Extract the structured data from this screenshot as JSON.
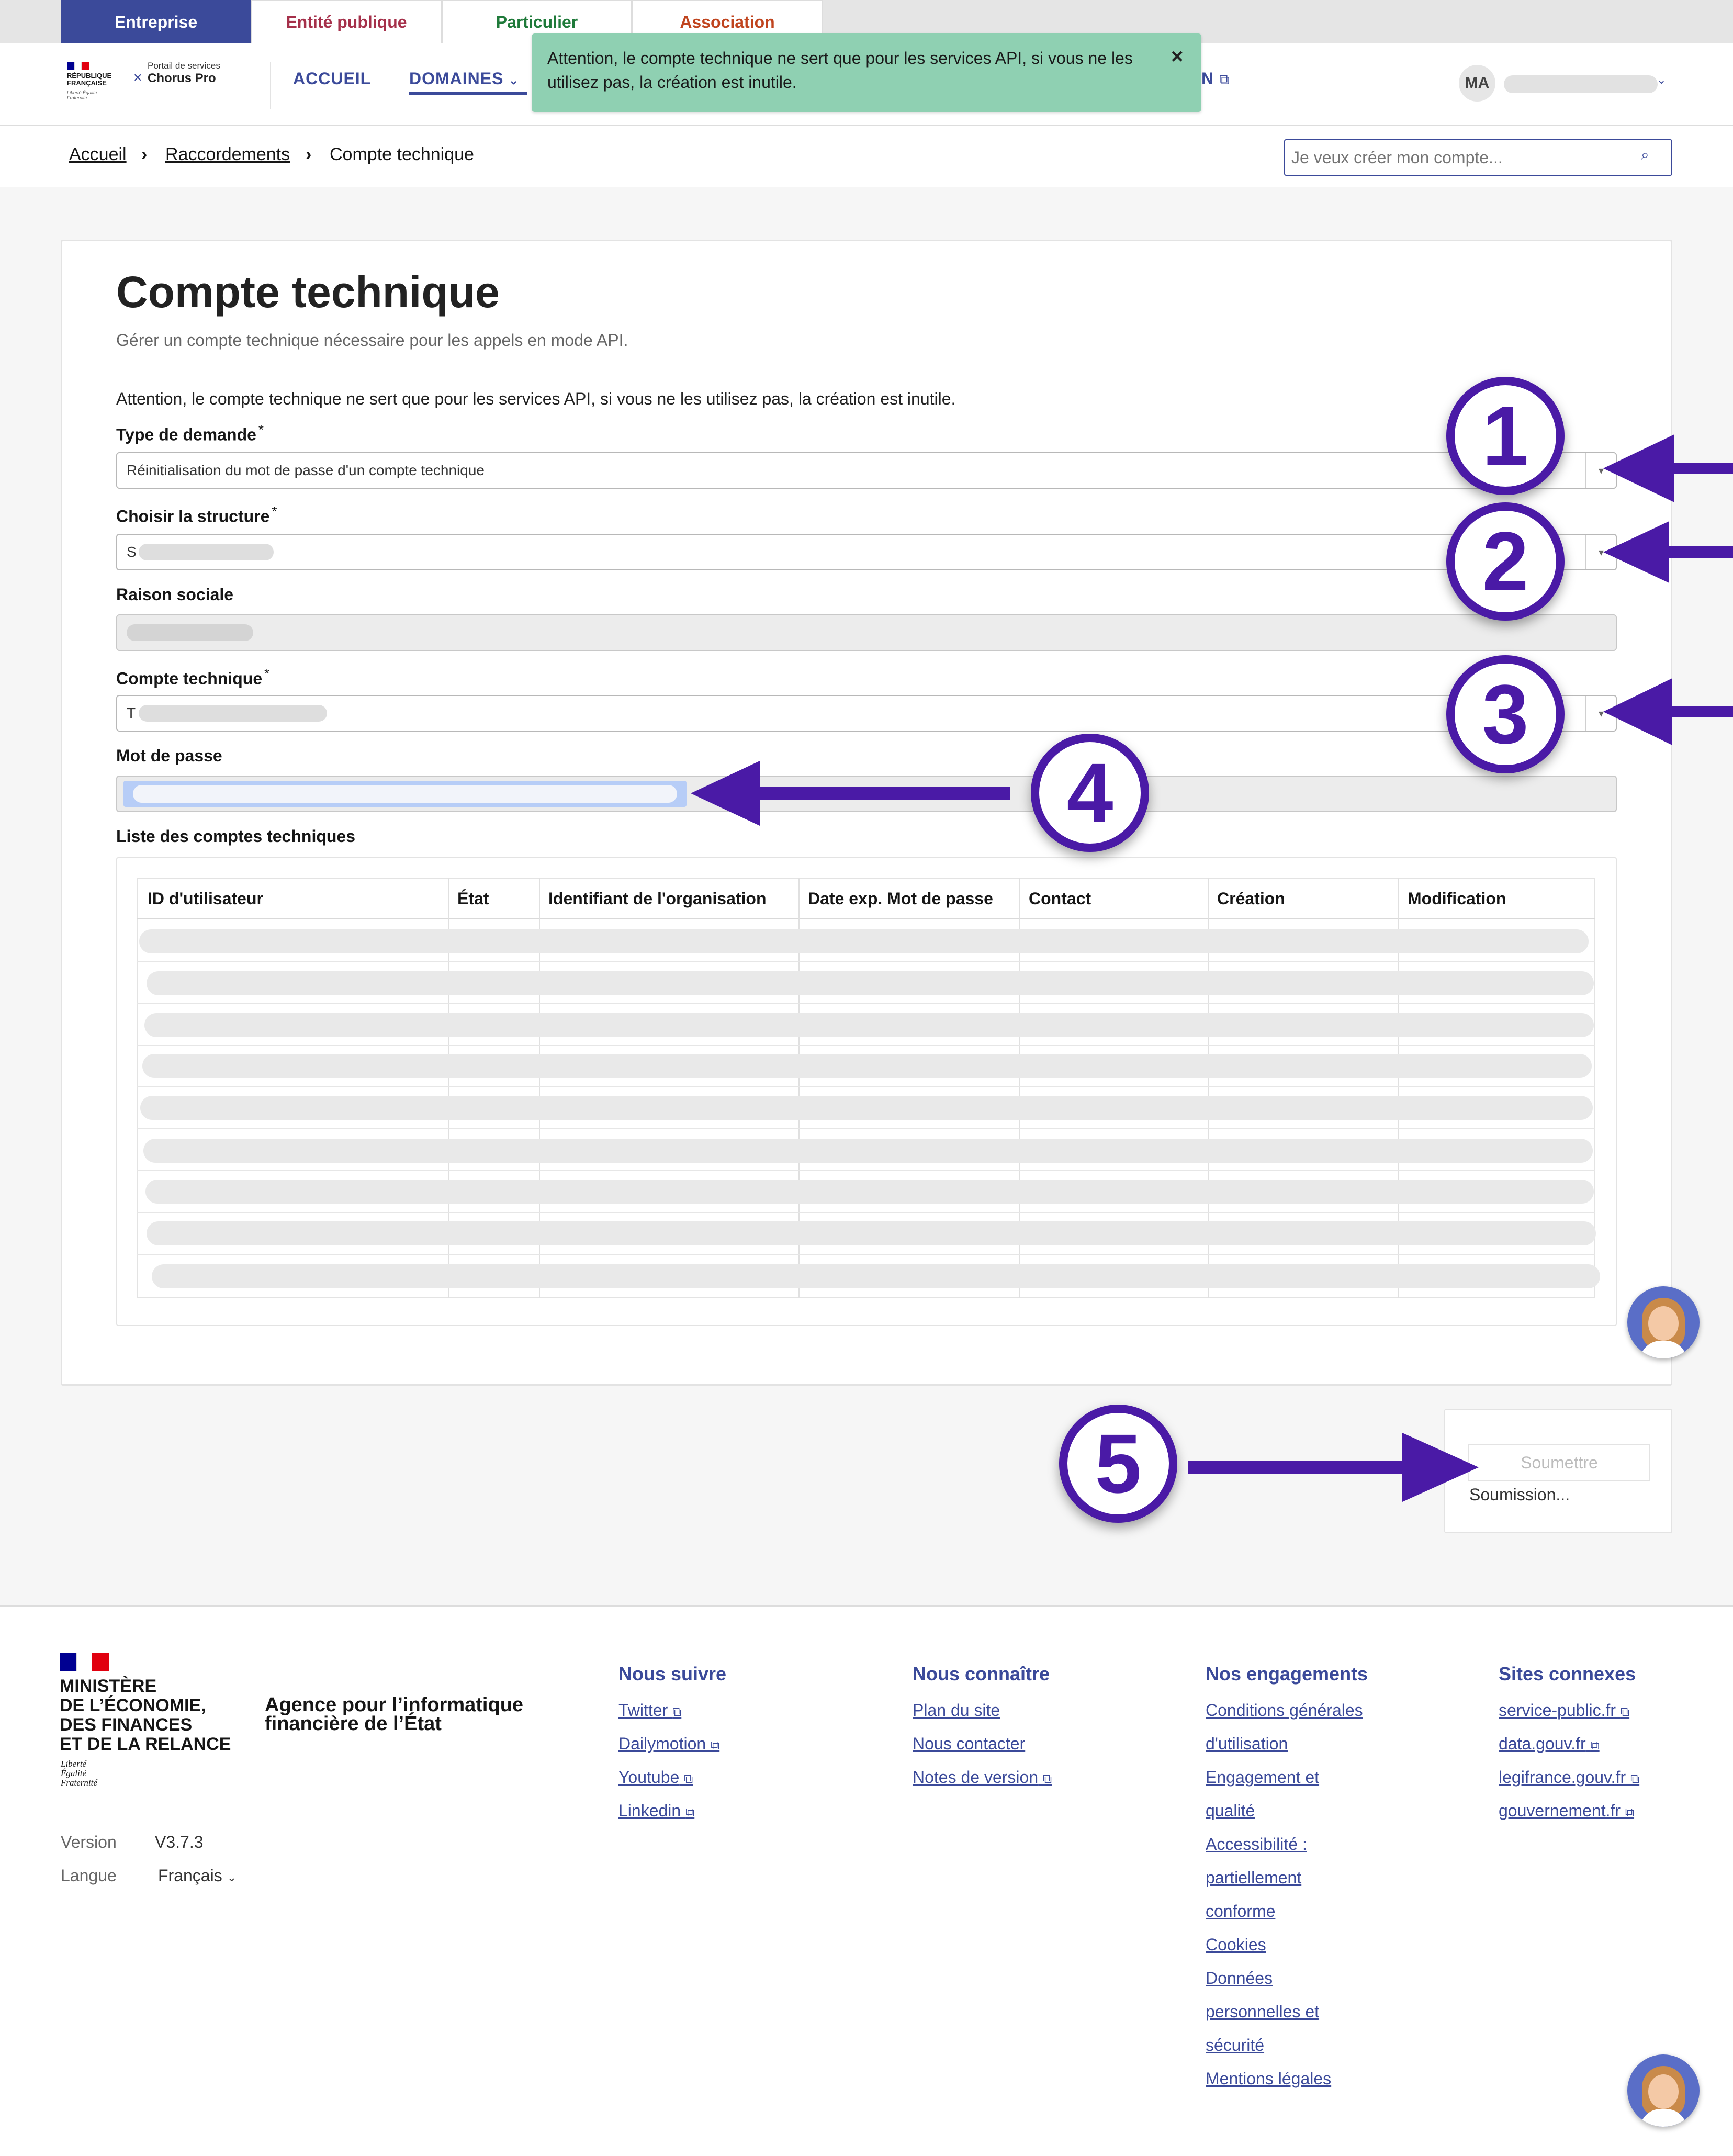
{
  "audience_tabs": [
    {
      "label": "Entreprise",
      "color": "#ffffff",
      "bg": "#3b4a9a"
    },
    {
      "label": "Entité publique",
      "color": "#a5304a",
      "bg": "#ffffff"
    },
    {
      "label": "Particulier",
      "color": "#1f7a3a",
      "bg": "#ffffff"
    },
    {
      "label": "Association",
      "color": "#c0441e",
      "bg": "#ffffff"
    }
  ],
  "header": {
    "logo_text_1": "RÉPUBLIQUE",
    "logo_text_2": "FRANÇAISE",
    "logo_motto": "Liberté Égalité Fraternité",
    "portal_label": "Portail de services",
    "portal_name": "Chorus Pro",
    "nav_home": "ACCUEIL",
    "nav_domains": "DOMAINES",
    "nav_partial": "N",
    "user_initials": "MA"
  },
  "toast": {
    "message": "Attention, le compte technique ne sert que pour les services API, si vous ne les utilisez pas, la création est inutile.",
    "close": "×",
    "bg": "#8fd0b2"
  },
  "breadcrumb": {
    "home": "Accueil",
    "parent": "Raccordements",
    "current": "Compte technique",
    "separator": "›"
  },
  "search": {
    "placeholder": "Je veux créer mon compte..."
  },
  "page": {
    "title": "Compte technique",
    "subtitle": "Gérer un compte technique nécessaire pour les appels en mode API.",
    "warning": "Attention, le compte technique ne sert que pour les services API, si vous ne les utilisez pas, la création est inutile."
  },
  "form": {
    "type_label": "Type de demande",
    "type_value": "Réinitialisation du mot de passe d'un compte technique",
    "structure_label": "Choisir la structure",
    "structure_value_prefix": "S",
    "raison_label": "Raison sociale",
    "compte_label": "Compte technique",
    "compte_value_prefix": "T",
    "password_label": "Mot de passe",
    "required_mark": "*"
  },
  "table": {
    "title": "Liste des comptes techniques",
    "columns": [
      "ID d'utilisateur",
      "État",
      "Identifiant de l'organisation",
      "Date exp. Mot de passe",
      "Contact",
      "Création",
      "Modification"
    ]
  },
  "submit": {
    "label": "Soumettre",
    "status": "Soumission..."
  },
  "annotations": [
    "1",
    "2",
    "3",
    "4",
    "5"
  ],
  "annotation_color": "#4a1aa6",
  "footer": {
    "ministry": [
      "MINISTÈRE",
      "DE L’ÉCONOMIE,",
      "DES FINANCES",
      "ET DE LA RELANCE"
    ],
    "ministry_motto": [
      "Liberté",
      "Égalité",
      "Fraternité"
    ],
    "agency": [
      "Agence pour l’informatique",
      "financière de l’État"
    ],
    "version_label": "Version",
    "version_value": "V3.7.3",
    "lang_label": "Langue",
    "lang_value": "Français",
    "col1_title": "Nous suivre",
    "col1_links": [
      "Twitter",
      "Dailymotion",
      "Youtube",
      "Linkedin"
    ],
    "col2_title": "Nous connaître",
    "col2_links": [
      "Plan du site",
      "Nous contacter",
      "Notes de version"
    ],
    "col3_title": "Nos engagements",
    "col3_links": [
      "Conditions générales",
      "d'utilisation",
      "Engagement et",
      "qualité",
      "Accessibilité :",
      "partiellement",
      "conforme",
      "Cookies",
      "Données",
      "personnelles et",
      "sécurité",
      "Mentions légales"
    ],
    "col4_title": "Sites connexes",
    "col4_links": [
      "service-public.fr",
      "data.gouv.fr",
      "legifrance.gouv.fr",
      "gouvernement.fr"
    ]
  }
}
